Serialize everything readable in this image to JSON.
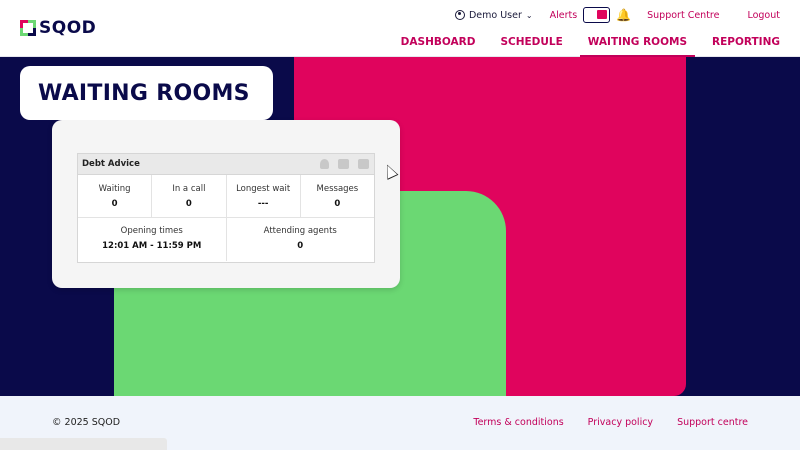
{
  "brand": {
    "name": "SQOD"
  },
  "topbar": {
    "user_name": "Demo User",
    "alerts_label": "Alerts",
    "support_label": "Support Centre",
    "logout_label": "Logout"
  },
  "nav": {
    "items": [
      {
        "label": "DASHBOARD"
      },
      {
        "label": "SCHEDULE"
      },
      {
        "label": "WAITING ROOMS"
      },
      {
        "label": "REPORTING"
      }
    ],
    "active": "WAITING ROOMS"
  },
  "page": {
    "title": "WAITING ROOMS"
  },
  "room": {
    "name": "Debt Advice",
    "stats": [
      {
        "label": "Waiting",
        "value": "0"
      },
      {
        "label": "In a call",
        "value": "0"
      },
      {
        "label": "Longest wait",
        "value": "---"
      },
      {
        "label": "Messages",
        "value": "0"
      }
    ],
    "opening_times_label": "Opening times",
    "opening_times_value": "12:01 AM - 11:59 PM",
    "attending_agents_label": "Attending agents",
    "attending_agents_value": "0"
  },
  "footer": {
    "copyright": "© 2025 SQOD",
    "links": [
      "Terms & conditions",
      "Privacy policy",
      "Support centre"
    ]
  },
  "colors": {
    "navy": "#0a0a4a",
    "pink": "#e0045d",
    "green": "#6bd873",
    "link": "#c2005a"
  },
  "icons": [
    "user-circle-icon",
    "chevron-down-icon",
    "bell-icon",
    "person-icon",
    "chat-add-icon",
    "inbox-icon"
  ]
}
